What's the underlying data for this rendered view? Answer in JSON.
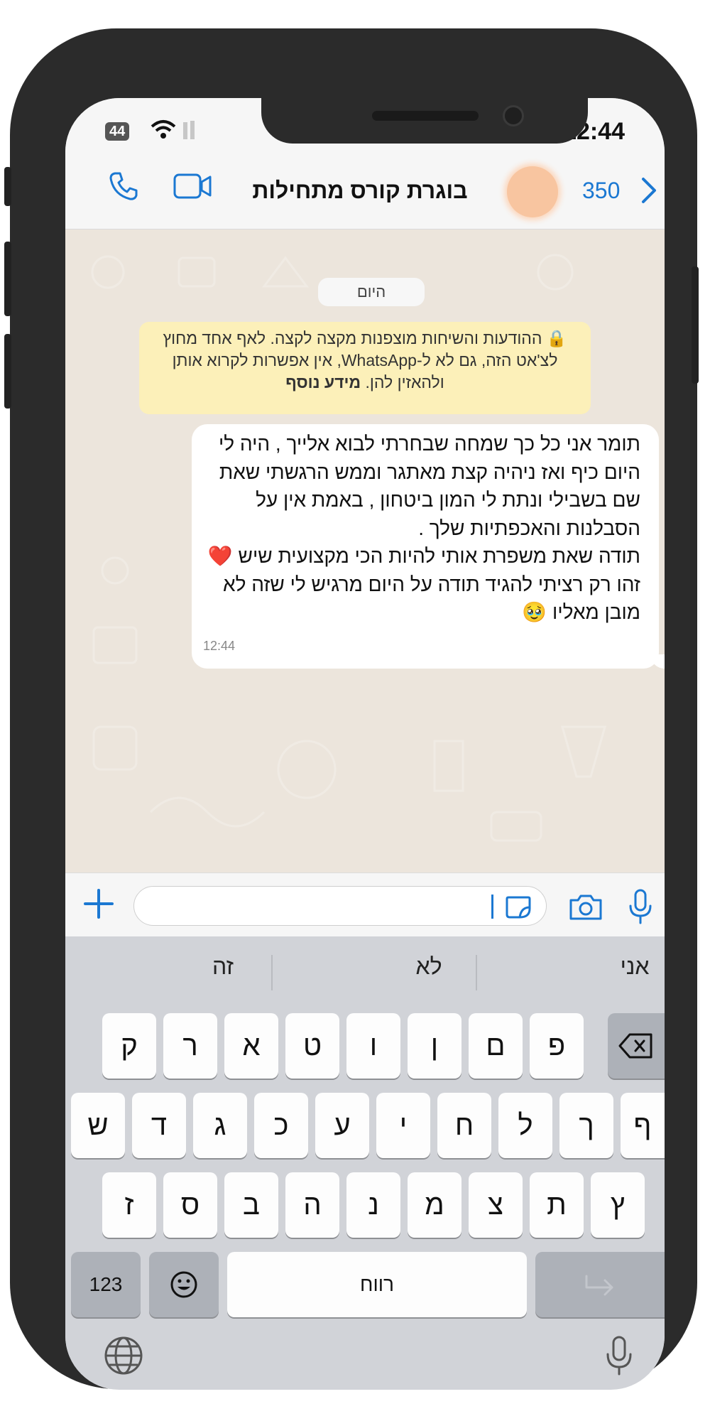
{
  "status_bar": {
    "time": "12:44",
    "battery_level": "44"
  },
  "header": {
    "title": "בוגרת קורס מתחילות",
    "back_count": "350",
    "icons": {
      "call": "phone-icon",
      "video": "video-camera-icon",
      "back": "chevron-right-icon",
      "avatar": "contact-avatar"
    }
  },
  "chat": {
    "date_chip": "היום",
    "notice": {
      "text": "ההודעות והשיחות מוצפנות מקצה לקצה. לאף אחד מחוץ לצ'אט הזה, גם לא ל-WhatsApp, אין אפשרות לקרוא אותן ולהאזין להן.",
      "link": "מידע נוסף"
    },
    "message": {
      "text": "תומר אני כל כך שמחה שבחרתי לבוא אלייך , היה לי היום כיף ואז ניהיה קצת מאתגר וממש הרגשתי שאת שם בשבילי ונתת לי המון ביטחון , באמת אין על הסבלנות והאכפתיות שלך .\nתודה שאת משפרת אותי להיות הכי מקצועית שיש ❤️\nזהו רק רציתי להגיד תודה על היום מרגיש לי שזה לא מובן מאליו 🥹",
      "time": "12:44"
    }
  },
  "input_bar": {
    "placeholder": "",
    "icons": {
      "plus": "plus-icon",
      "sticker": "sticker-icon",
      "camera": "camera-icon",
      "mic": "microphone-icon"
    }
  },
  "keyboard": {
    "suggestions": [
      "אני",
      "לא",
      "זה"
    ],
    "row1": [
      "ק",
      "ר",
      "א",
      "ט",
      "ו",
      "ן",
      "ם",
      "פ"
    ],
    "row2": [
      "ש",
      "ד",
      "ג",
      "כ",
      "ע",
      "י",
      "ח",
      "ל",
      "ך",
      "ף"
    ],
    "row3": [
      "ז",
      "ס",
      "ב",
      "ה",
      "נ",
      "מ",
      "צ",
      "ת",
      "ץ"
    ],
    "numbers_key": "123",
    "space_key": "רווח",
    "icons": {
      "backspace": "backspace-icon",
      "emoji": "emoji-icon",
      "return": "return-icon",
      "globe": "globe-icon",
      "dictation": "dictation-mic-icon"
    }
  },
  "colors": {
    "accent": "#1b78d2",
    "chat_background": "#ece5dc",
    "notice_background": "#fcf0b9",
    "bubble_background": "#ffffff",
    "heart": "#e0272a"
  }
}
